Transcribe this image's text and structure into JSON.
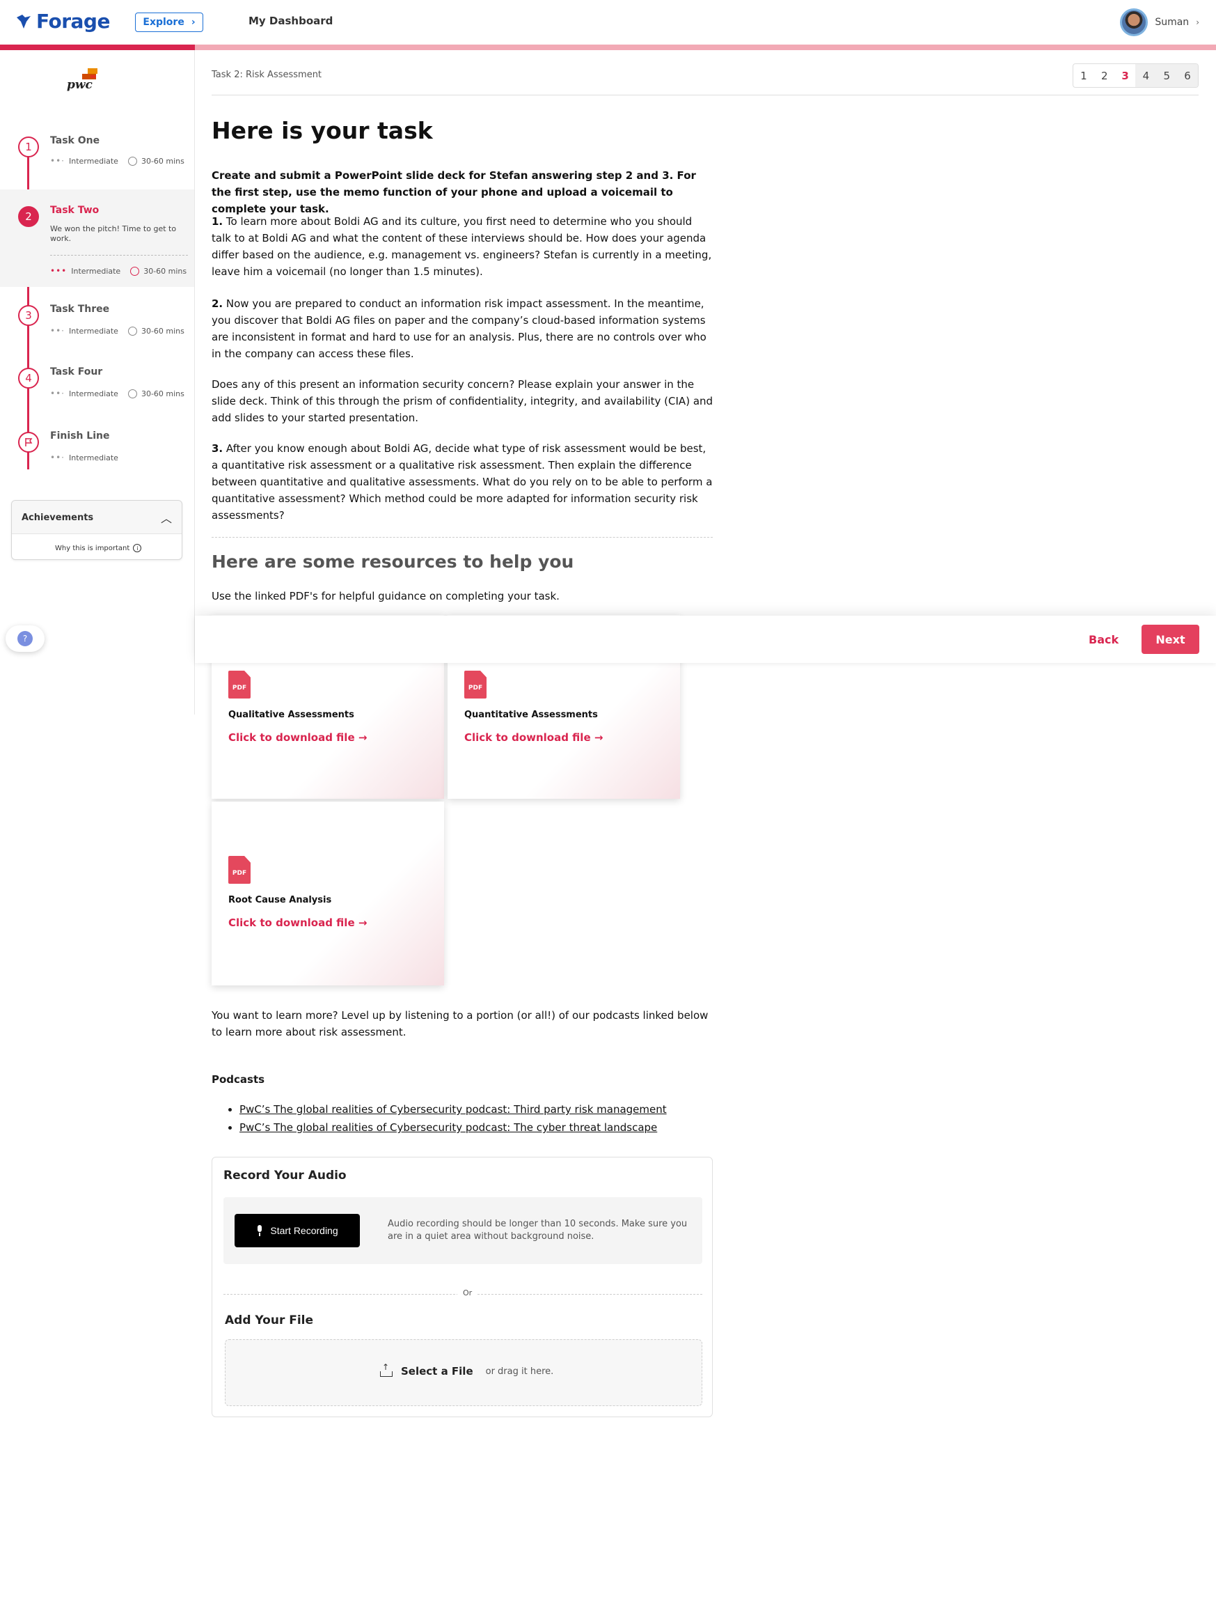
{
  "header": {
    "logo_text": "Forage",
    "explore_label": "Explore",
    "dashboard_label": "My Dashboard",
    "user_name": "Suman",
    "progress_fraction": 0.16,
    "colors": {
      "brand": "#1a4fae",
      "accent": "#d9254f"
    }
  },
  "sidebar": {
    "company_logo": "pwc",
    "tasks": [
      {
        "number": "1",
        "title": "Task One",
        "level": "Intermediate",
        "duration": "30-60 mins",
        "active": false
      },
      {
        "number": "2",
        "title": "Task Two",
        "description": "We won the pitch! Time to get to work.",
        "level": "Intermediate",
        "duration": "30-60 mins",
        "active": true
      },
      {
        "number": "3",
        "title": "Task Three",
        "level": "Intermediate",
        "duration": "30-60 mins",
        "active": false
      },
      {
        "number": "4",
        "title": "Task Four",
        "level": "Intermediate",
        "duration": "30-60 mins",
        "active": false
      },
      {
        "number": "",
        "title": "Finish Line",
        "level": "Intermediate",
        "active": false,
        "icon": "flag-icon"
      }
    ],
    "achievements": {
      "title": "Achievements",
      "why_label": "Why this is important"
    }
  },
  "main": {
    "breadcrumb": "Task 2: Risk Assessment",
    "pager": {
      "pages": [
        "1",
        "2",
        "3",
        "4",
        "5",
        "6"
      ],
      "current": "3"
    },
    "heading": "Here is your task",
    "intro": "Create and submit a PowerPoint slide deck for Stefan answering step 2 and 3. For the first step, use the memo function of your phone and upload a voicemail to complete your task.",
    "step1_num": "1.",
    "step1": " To learn more about Boldi AG and its culture, you first need to determine who you should talk to at Boldi AG and what the content of these interviews should be. How does your agenda differ based on the audience, e.g. management vs. engineers? Stefan is currently in a meeting, leave him a voicemail (no longer than 1.5 minutes).",
    "step2_num": "2.",
    "step2": " Now you are prepared to conduct an information risk impact assessment. In the meantime, you discover that Boldi AG files on paper and the company’s cloud-based information systems are inconsistent in format and hard to use for an analysis. Plus, there are no controls over who in the company can access these files.",
    "step2b": "Does any of this present an information security concern? Please explain your answer in the slide deck. Think of this through the prism of confidentiality, integrity, and availability (CIA) and add slides to your started presentation.",
    "step3_num": "3.",
    "step3": " After you know enough about Boldi AG, decide what type of risk assessment would be best, a quantitative risk assessment or a qualitative risk assessment. Then explain the difference between quantitative and qualitative assessments. What do you rely on to be able to perform a quantitative assessment? Which method could be more adapted for information security risk assessments?",
    "resources_heading": "Here are some resources to help you",
    "resources_intro": "Use the linked PDF's for helpful guidance on completing your task.",
    "resources": [
      {
        "icon_label": "PDF",
        "title": "Qualitative Assessments",
        "link": "Click to download file →"
      },
      {
        "icon_label": "PDF",
        "title": "Quantitative Assessments",
        "link": "Click to download file →"
      },
      {
        "icon_label": "PDF",
        "title": "Root Cause Analysis",
        "link": "Click to download file →"
      }
    ],
    "learn_more": "You want to learn more? Level up by listening to a portion (or all!) of our podcasts linked below to learn more about risk assessment.",
    "podcasts_title": "Podcasts",
    "podcasts": [
      "PwC’s The global realities of Cybersecurity podcast: Third party risk management",
      "PwC’s The global realities of Cybersecurity podcast: The cyber threat landscape"
    ],
    "nav": {
      "back_label": "Back",
      "next_label": "Next"
    }
  },
  "submission": {
    "record_title": "Record Your Audio",
    "record_button": "Start Recording",
    "record_note": "Audio recording should be longer than 10 seconds. Make sure you are in a quiet area without background noise.",
    "or_label": "Or",
    "add_file_title": "Add Your File",
    "select_file_label": "Select a File",
    "drag_label": "or drag it here."
  }
}
